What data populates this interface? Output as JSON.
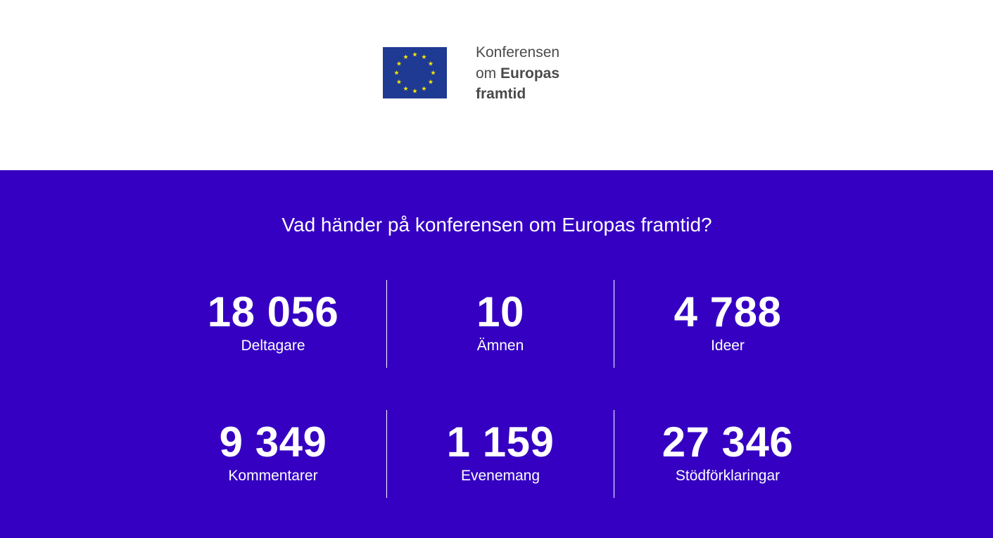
{
  "colors": {
    "header_bg": "#ffffff",
    "stats_bg": "#3500c2",
    "flag_blue": "#1f3a93",
    "flag_star": "#f7e600",
    "logo_text": "#4a4a4a"
  },
  "logo": {
    "line1": "Konferensen",
    "line2_prefix": "om ",
    "line2_bold": "Europas",
    "line3_bold": "framtid",
    "icon": "eu-flag-icon"
  },
  "stats": {
    "title": "Vad händer på konferensen om Europas framtid?",
    "items": [
      {
        "value": "18 056",
        "label": "Deltagare"
      },
      {
        "value": "10",
        "label": "Ämnen"
      },
      {
        "value": "4 788",
        "label": "Ideer"
      },
      {
        "value": "9 349",
        "label": "Kommentarer"
      },
      {
        "value": "1 159",
        "label": "Evenemang"
      },
      {
        "value": "27 346",
        "label": "Stödförklaringar"
      }
    ]
  }
}
